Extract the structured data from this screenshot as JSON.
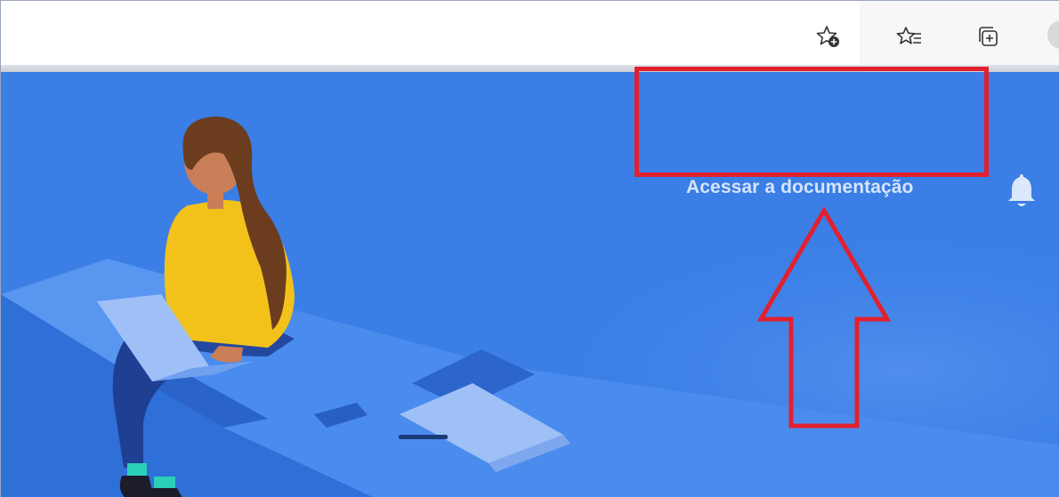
{
  "browser": {
    "icons": {
      "add_favorite": "star-plus-icon",
      "favorites": "star-list-icon",
      "collections": "collections-icon",
      "profile": "avatar"
    }
  },
  "header": {
    "docs_link": "Acessar a documentação",
    "notifications_icon": "bell-icon"
  },
  "annotation": {
    "box_color": "#e2202f",
    "arrow_color": "#e2202f"
  },
  "colors": {
    "hero_bg": "#3a7ee6",
    "link_text": "#d6e4fb"
  }
}
